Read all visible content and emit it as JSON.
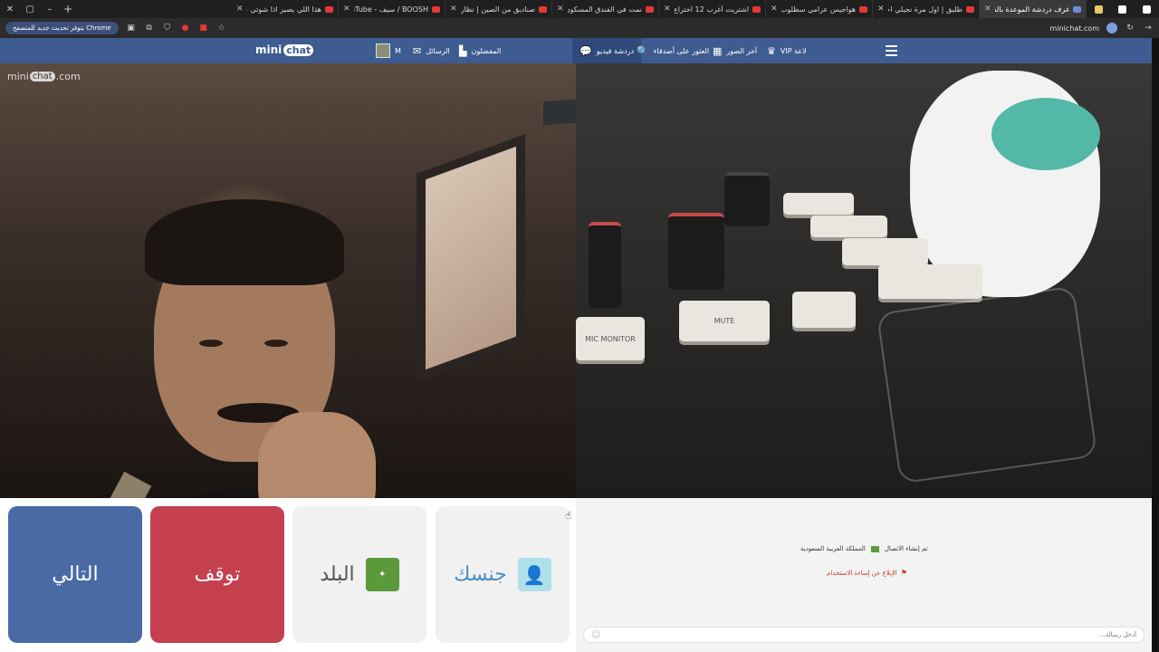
{
  "browser": {
    "tabs": [
      {
        "title": "هذا اللي يصير اذا شوتي طفشان",
        "active": false
      },
      {
        "title": "BOOSH / سيف - YouTube",
        "active": false
      },
      {
        "title": "صناديق من الصين | نظارة فيها",
        "active": false
      },
      {
        "title": "نمت في الفندق المسكون | اصوات",
        "active": false
      },
      {
        "title": "اشتريت أغرب 12 اختراع من شي إن",
        "active": false
      },
      {
        "title": "هواجيس عزامي سطلوب - ٠٠٠ - ad",
        "active": false
      },
      {
        "title": "طليق | اول مرة نجيلي اجرب سيارة",
        "active": false
      },
      {
        "title": "غرف دردشة الموعدة بالفيديو",
        "active": true
      }
    ],
    "update_label": "يتوفر تحديث جديد للمتصفح Chrome",
    "url": "minichat.com"
  },
  "site": {
    "brand_prefix": "mini",
    "brand_suffix": "chat",
    "nav": {
      "username": "M",
      "messages": "الرسائل",
      "favorites": "المفضلون",
      "video_chat": "دردشة فيديو",
      "find_friends": "العثور على أصدقاء",
      "latest_photos": "آخر الصور",
      "vip": "VIP لاعة"
    }
  },
  "watermark": {
    "prefix": "mini",
    "bubble": "chat",
    "suffix": ".com"
  },
  "controls": {
    "next": "التالي",
    "stop": "توقف",
    "country": "البلد",
    "gender": "جنسك"
  },
  "chat": {
    "connected": "تم إنشاء الاتصال",
    "country": "المملكة العربية السعودية",
    "report": "الإبلاغ عن إساءة الاستخدام",
    "input_placeholder": "أدخل رسالة..."
  },
  "device_keys": {
    "mute": "MUTE",
    "mic_monitor": "MIC MONITOR"
  },
  "colors": {
    "nav_bg": "#3e5c91",
    "next_btn": "#4a6aa6",
    "stop_btn": "#c4404f"
  }
}
